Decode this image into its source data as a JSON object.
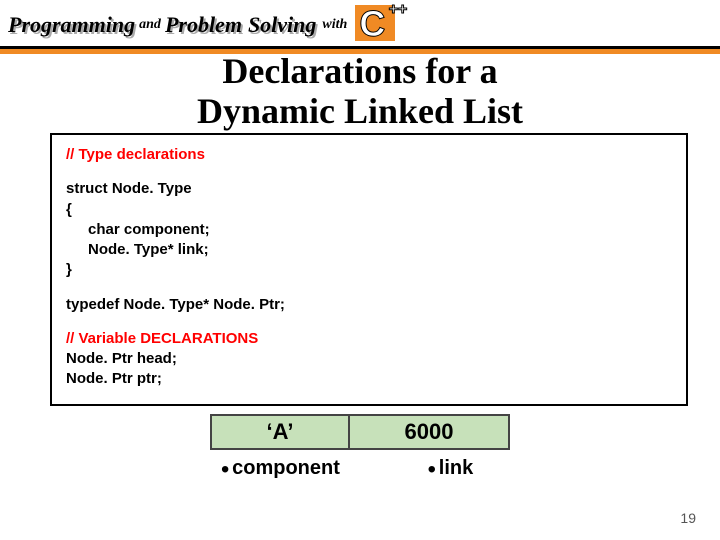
{
  "header": {
    "w1": "Programming",
    "and": "and",
    "w2": "Problem",
    "w3": "Solving",
    "with": "with",
    "logo_c": "C",
    "logo_pp": "++"
  },
  "title": {
    "line1": "Declarations for a",
    "line2": "Dynamic Linked List"
  },
  "code": {
    "c1": "// Type declarations",
    "c2": "struct Node. Type",
    "c3": "{",
    "c4": "char component;",
    "c5": "Node. Type* link;",
    "c6": "}",
    "c7": "typedef  Node. Type*  Node. Ptr;",
    "c8": "// Variable DECLARATIONS",
    "c9": "Node. Ptr  head;",
    "c10": "Node. Ptr  ptr;"
  },
  "node": {
    "val_component": "‘A’",
    "val_link": "6000",
    "label_component": "component",
    "label_link": "link",
    "dot": "."
  },
  "page": "19"
}
